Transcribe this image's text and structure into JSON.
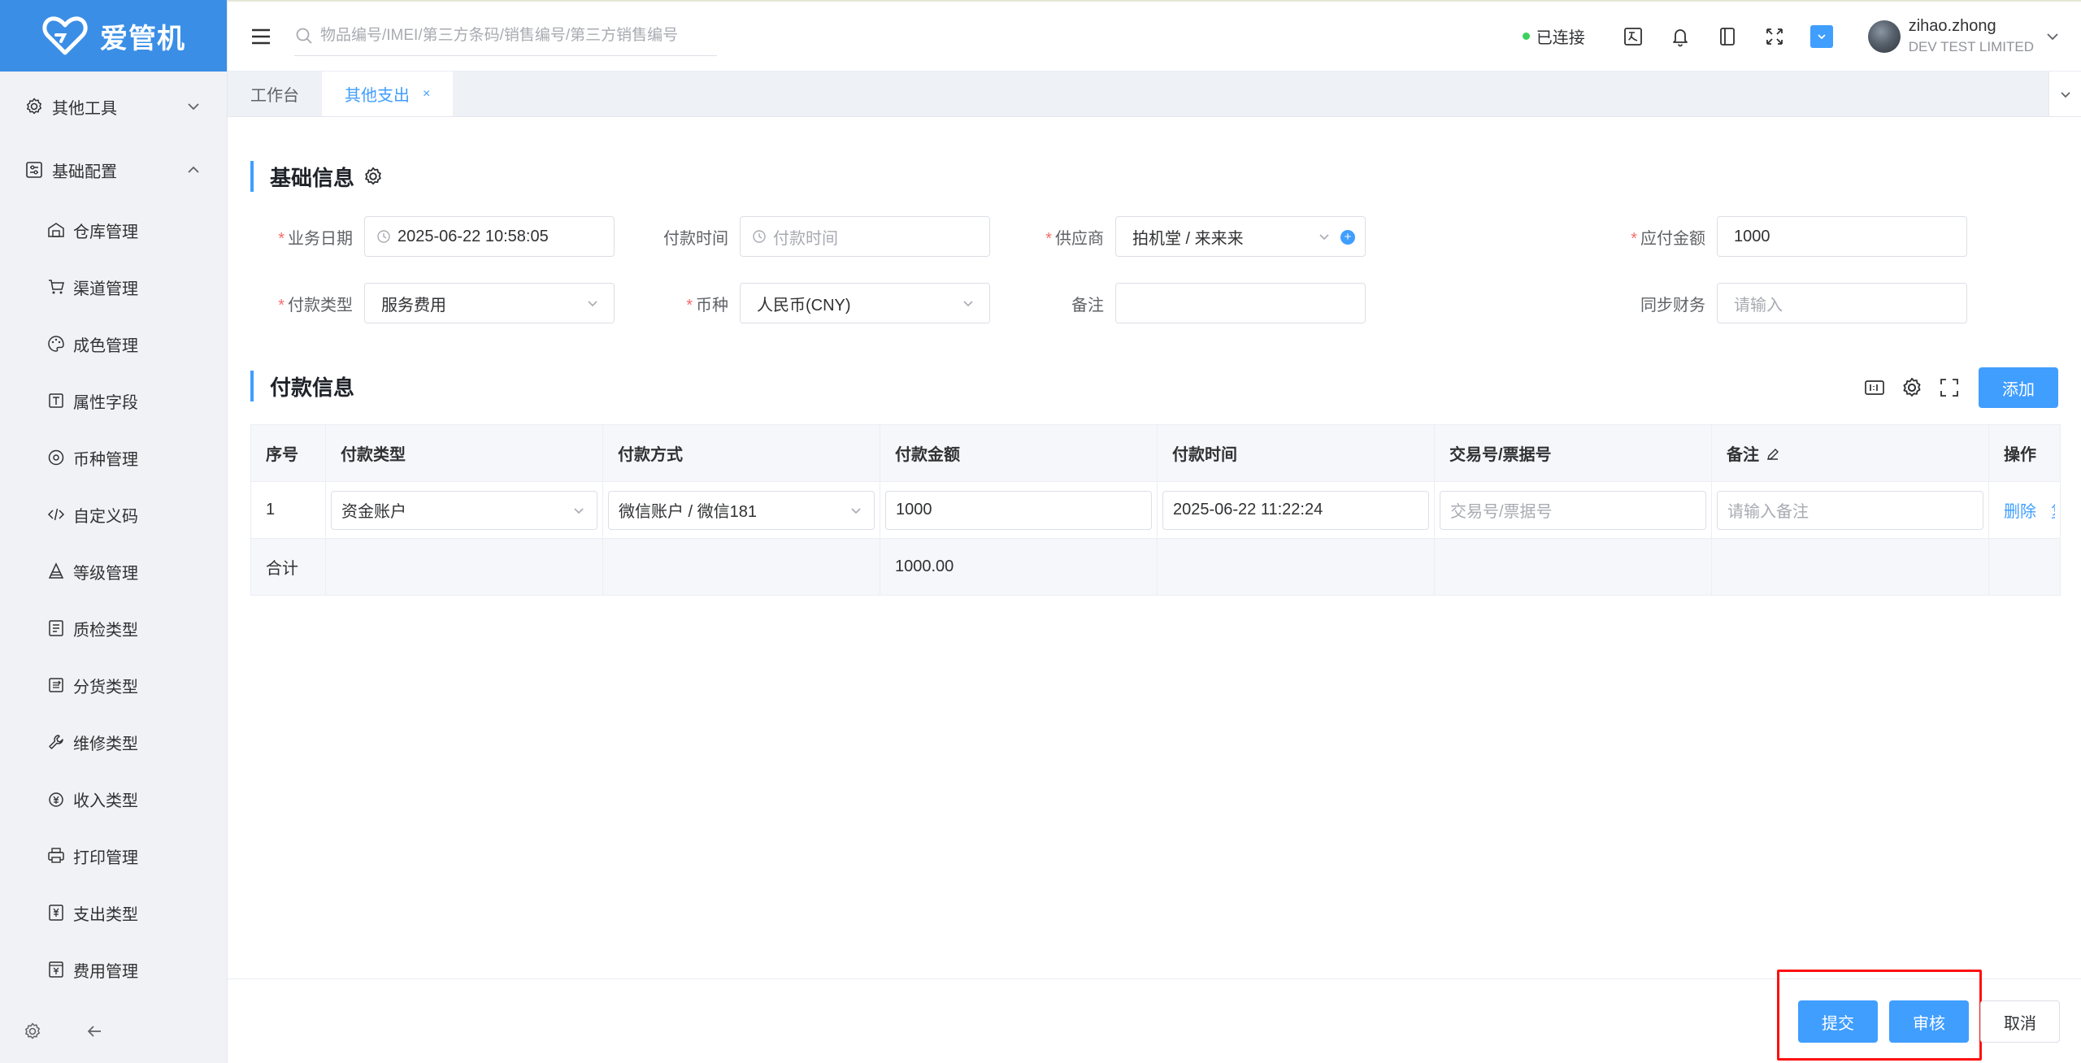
{
  "brand": {
    "name": "爱管机",
    "logo_icon": "heart-logo-icon"
  },
  "sidebar": {
    "groups": [
      {
        "label": "其他工具",
        "icon": "gear-icon",
        "expanded": false
      },
      {
        "label": "基础配置",
        "icon": "settings-panel-icon",
        "expanded": true
      }
    ],
    "items": [
      {
        "label": "仓库管理",
        "icon": "warehouse-icon"
      },
      {
        "label": "渠道管理",
        "icon": "cart-icon"
      },
      {
        "label": "成色管理",
        "icon": "palette-icon"
      },
      {
        "label": "属性字段",
        "icon": "text-box-icon"
      },
      {
        "label": "币种管理",
        "icon": "coin-icon"
      },
      {
        "label": "自定义码",
        "icon": "code-icon"
      },
      {
        "label": "等级管理",
        "icon": "pyramid-icon"
      },
      {
        "label": "质检类型",
        "icon": "checklist-icon"
      },
      {
        "label": "分货类型",
        "icon": "sort-icon"
      },
      {
        "label": "维修类型",
        "icon": "wrench-icon"
      },
      {
        "label": "收入类型",
        "icon": "money-bag-icon"
      },
      {
        "label": "打印管理",
        "icon": "printer-icon"
      },
      {
        "label": "支出类型",
        "icon": "expense-icon"
      },
      {
        "label": "费用管理",
        "icon": "fee-icon"
      }
    ]
  },
  "header": {
    "search_placeholder": "物品编号/IMEI/第三方条码/销售编号/第三方销售编号",
    "status": "已连接",
    "user": {
      "name": "zihao.zhong",
      "company": "DEV TEST LIMITED"
    }
  },
  "tabs": [
    {
      "label": "工作台",
      "active": false
    },
    {
      "label": "其他支出",
      "active": true,
      "close": "×"
    }
  ],
  "basic": {
    "title": "基础信息",
    "fields": {
      "biz_date": {
        "label": "业务日期",
        "value": "2025-06-22 10:58:05"
      },
      "pay_time": {
        "label": "付款时间",
        "placeholder": "付款时间"
      },
      "supplier": {
        "label": "供应商",
        "value": "拍机堂 / 来来来"
      },
      "amount_due": {
        "label": "应付金额",
        "value": "1000"
      },
      "pay_type": {
        "label": "付款类型",
        "value": "服务费用"
      },
      "currency": {
        "label": "币种",
        "value": "人民币(CNY)"
      },
      "remark": {
        "label": "备注",
        "value": ""
      },
      "sync": {
        "label": "同步财务",
        "placeholder": "请输入"
      }
    }
  },
  "payment": {
    "title": "付款信息",
    "add_label": "添加",
    "columns": [
      "序号",
      "付款类型",
      "付款方式",
      "付款金额",
      "付款时间",
      "交易号/票据号",
      "备注",
      "操作"
    ],
    "rows": [
      {
        "index": "1",
        "type": "资金账户",
        "method": "微信账户 / 微信181",
        "amount": "1000",
        "time": "2025-06-22 11:22:24",
        "txn_placeholder": "交易号/票据号",
        "remark_placeholder": "请输入备注",
        "actions": [
          "删除",
          "复"
        ]
      }
    ],
    "summary": {
      "label": "合计",
      "amount": "1000.00"
    }
  },
  "footer": {
    "submit": "提交",
    "audit": "审核",
    "cancel": "取消"
  },
  "colors": {
    "primary": "#409eff",
    "logo_bg": "#3a8ee6",
    "highlight": "#ff1010",
    "required": "#f56c6c"
  }
}
